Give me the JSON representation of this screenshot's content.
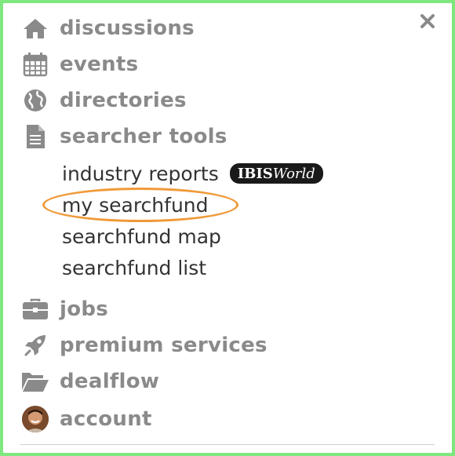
{
  "menu": {
    "discussions": "discussions",
    "events": "events",
    "directories": "directories",
    "searcher_tools": "searcher tools",
    "jobs": "jobs",
    "premium_services": "premium services",
    "dealflow": "dealflow",
    "account": "account"
  },
  "submenu": {
    "industry_reports": "industry reports",
    "my_searchfund": "my searchfund",
    "searchfund_map": "searchfund map",
    "searchfund_list": "searchfund list"
  },
  "badge": {
    "bold": "IBIS",
    "italic": "World"
  },
  "icons": {
    "close": "close-icon",
    "home": "home-icon",
    "calendar": "calendar-icon",
    "globe": "globe-icon",
    "document": "document-icon",
    "briefcase": "briefcase-icon",
    "rocket": "rocket-icon",
    "folder": "folder-open-icon"
  },
  "colors": {
    "frame": "#7ee87e",
    "menu_text": "#8a8a8a",
    "sub_text": "#333333",
    "highlight": "#f09a3a"
  }
}
